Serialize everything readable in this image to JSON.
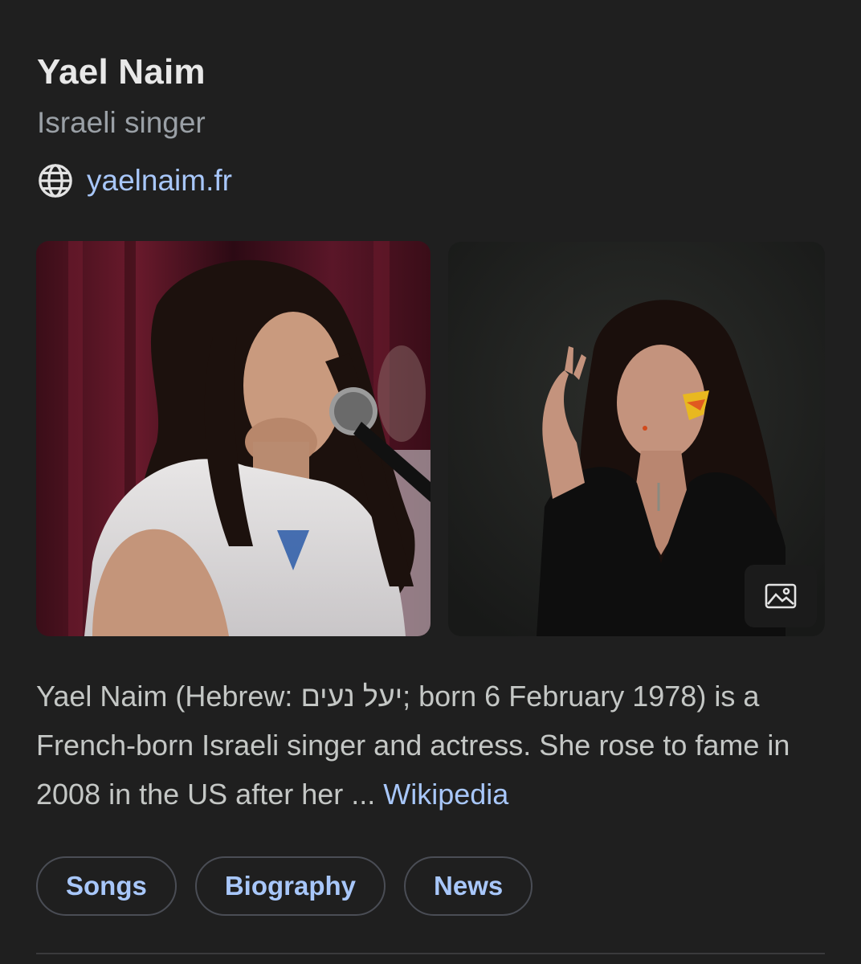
{
  "entity": {
    "name": "Yael Naim",
    "subtitle": "Israeli singer",
    "website": "yaelnaim.fr"
  },
  "images": [
    {
      "name": "singer-performing-photo"
    },
    {
      "name": "singer-portrait-photo",
      "icon": "image-icon"
    }
  ],
  "description": {
    "text": "Yael Naim (Hebrew: יעל נעים; born 6 February 1978) is a French-born Israeli singer and actress. She rose to fame in 2008 in the US after her ... ",
    "source": "Wikipedia"
  },
  "chips": [
    {
      "label": "Songs"
    },
    {
      "label": "Biography"
    },
    {
      "label": "News"
    }
  ],
  "colors": {
    "background": "#1f1f1f",
    "link": "#a8c7fa",
    "subtitle": "#9aa0a6",
    "chip_border": "#4a4d55"
  }
}
